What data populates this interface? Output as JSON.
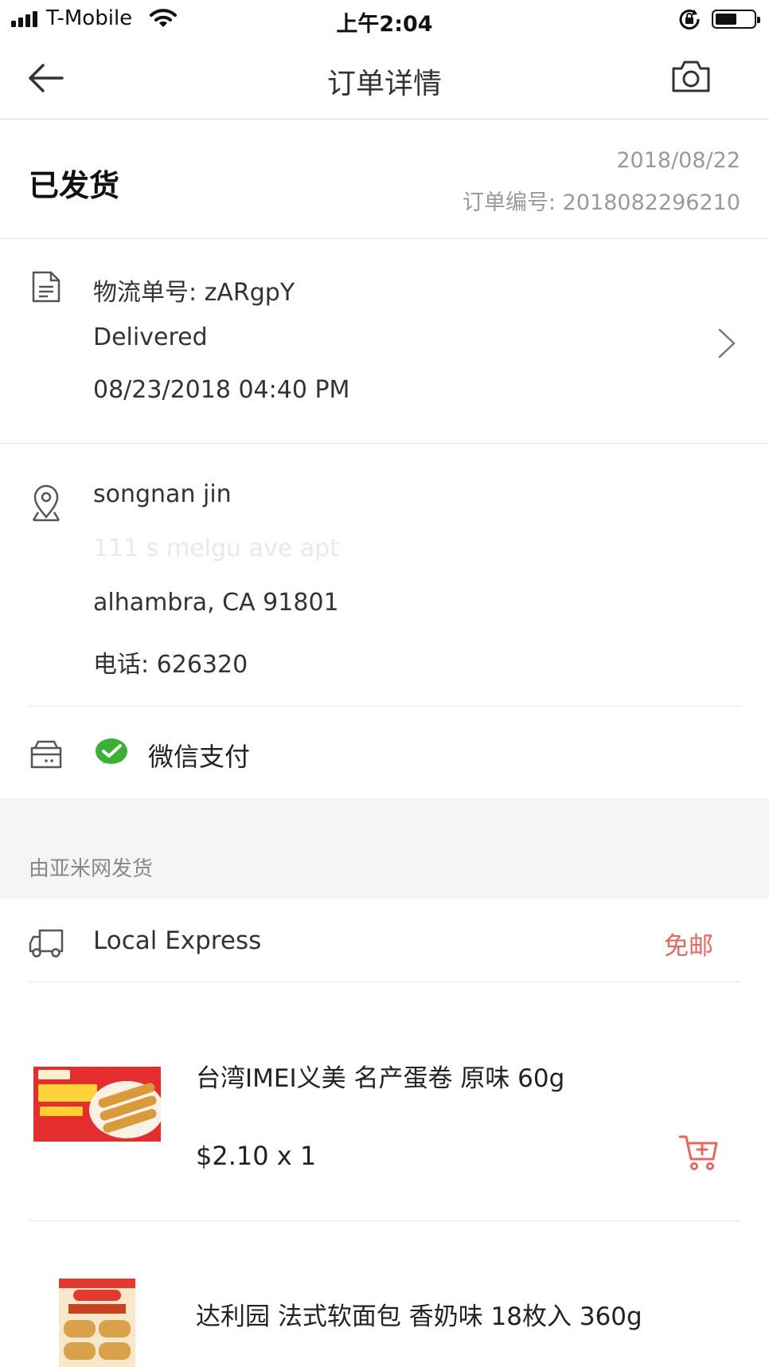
{
  "status_bar": {
    "carrier": "T-Mobile",
    "time": "上午2:04",
    "battery_level": 0.55
  },
  "nav": {
    "title": "订单详情",
    "back_icon": "arrow-left-icon",
    "camera_icon": "camera-icon"
  },
  "order": {
    "status": "已发货",
    "date": "2018/08/22",
    "number": "订单编号: 2018082296210"
  },
  "logistics": {
    "tracking": "物流单号: zARgpY",
    "status": "Delivered",
    "time": "08/23/2018 04:40 PM"
  },
  "address": {
    "name": "songnan jin",
    "street": "111 s melgu ave apt",
    "city": "alhambra, CA 91801",
    "phone": "电话: 626320"
  },
  "payment": {
    "method": "微信支付",
    "brand_color": "#3cb034"
  },
  "shipper": {
    "label": "由亚米网发货"
  },
  "shipping": {
    "method": "Local Express",
    "fee": "免邮"
  },
  "products": [
    {
      "name": "台湾IMEI义美 名产蛋卷 原味 60g",
      "price": "$2.10 x 1"
    },
    {
      "name": "达利园  法式软面包 香奶味 18枚入 360g",
      "price": ""
    }
  ],
  "colors": {
    "accent": "#e8675f",
    "muted_text": "#9a9a9a"
  }
}
